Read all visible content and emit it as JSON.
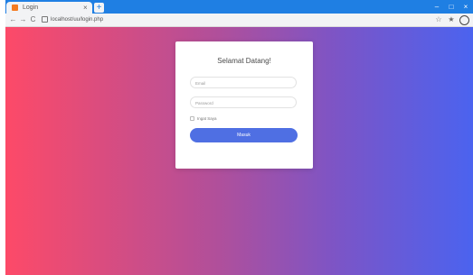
{
  "browser": {
    "tab_title": "Login",
    "tab_close": "×",
    "new_tab": "+",
    "window_controls": [
      "–",
      "□",
      "×"
    ],
    "url": "localhost/uu/login.php",
    "nav": {
      "back": "←",
      "forward": "→",
      "reload": "C"
    },
    "toolbar_icons": {
      "star": "☆",
      "extension": "★"
    },
    "accent": "#1f7fe3"
  },
  "login": {
    "title": "Selamat Datang!",
    "email_placeholder": "Email",
    "password_placeholder": "Password",
    "remember_label": "Ingat Saya",
    "submit_label": "Masuk",
    "button_color": "#4f6fe3"
  },
  "theme": {
    "gradient_start": "#fd4a68",
    "gradient_end": "#4b63ef"
  }
}
